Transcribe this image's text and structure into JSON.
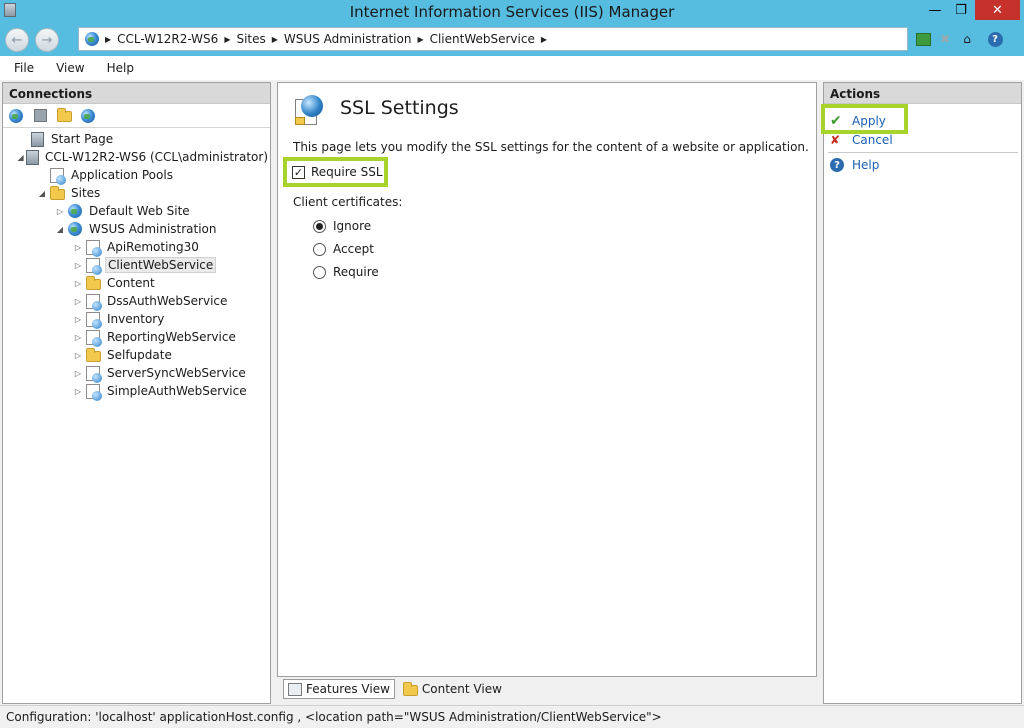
{
  "window": {
    "title": "Internet Information Services (IIS) Manager",
    "minimize": "—",
    "maximize": "❐",
    "close": "✕"
  },
  "address": {
    "breadcrumbs": [
      "CCL-W12R2-WS6",
      "Sites",
      "WSUS Administration",
      "ClientWebService"
    ],
    "separator": "▶"
  },
  "menu": {
    "file": "File",
    "view": "View",
    "help": "Help"
  },
  "connections": {
    "header": "Connections",
    "tree": [
      {
        "label": "Start Page",
        "indent": 0
      },
      {
        "label": "CCL-W12R2-WS6 (CCL\\administrator)",
        "indent": 0
      },
      {
        "label": "Application Pools",
        "indent": 1
      },
      {
        "label": "Sites",
        "indent": 1
      },
      {
        "label": "Default Web Site",
        "indent": 2
      },
      {
        "label": "WSUS Administration",
        "indent": 2
      },
      {
        "label": "ApiRemoting30",
        "indent": 3
      },
      {
        "label": "ClientWebService",
        "indent": 3
      },
      {
        "label": "Content",
        "indent": 3
      },
      {
        "label": "DssAuthWebService",
        "indent": 3
      },
      {
        "label": "Inventory",
        "indent": 3
      },
      {
        "label": "ReportingWebService",
        "indent": 3
      },
      {
        "label": "Selfupdate",
        "indent": 3
      },
      {
        "label": "ServerSyncWebService",
        "indent": 3
      },
      {
        "label": "SimpleAuthWebService",
        "indent": 3
      }
    ]
  },
  "feature": {
    "title": "SSL Settings",
    "description": "This page lets you modify the SSL settings for the content of a website or application.",
    "require_ssl_label": "Require SSL",
    "require_ssl_checked": true,
    "client_certificates_label": "Client certificates:",
    "options": [
      "Ignore",
      "Accept",
      "Require"
    ],
    "selected_option": "Ignore"
  },
  "view_tabs": {
    "features": "Features View",
    "content": "Content View"
  },
  "actions": {
    "header": "Actions",
    "apply": "Apply",
    "cancel": "Cancel",
    "help": "Help"
  },
  "colors": {
    "highlight": "#a7d32b",
    "titlebar": "#56bde0",
    "link": "#1a5fb4"
  },
  "status": {
    "text": "Configuration: 'localhost' applicationHost.config , <location path=\"WSUS Administration/ClientWebService\">"
  }
}
